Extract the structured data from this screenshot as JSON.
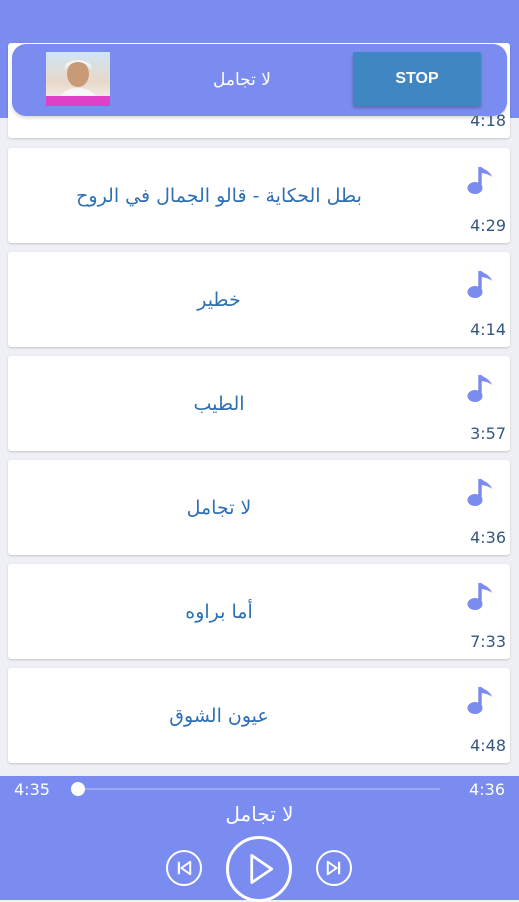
{
  "now_playing": {
    "title": "لا تجامل",
    "stop_label": "STOP"
  },
  "songs": [
    {
      "title": "",
      "duration": "4:18"
    },
    {
      "title": "بطل الحكاية - قالو الجمال في الروح",
      "duration": "4:29"
    },
    {
      "title": "خطير",
      "duration": "4:14"
    },
    {
      "title": "الطيب",
      "duration": "3:57"
    },
    {
      "title": "لا تجامل",
      "duration": "4:36"
    },
    {
      "title": "أما براوه",
      "duration": "7:33"
    },
    {
      "title": "عيون الشوق",
      "duration": "4:48"
    }
  ],
  "player": {
    "elapsed": "4:35",
    "total": "4:36",
    "progress": 0.0,
    "title": "لا تجامل"
  },
  "icons": {
    "song": "music-note-icon",
    "prev": "skip-previous-icon",
    "play": "play-icon",
    "next": "skip-next-icon"
  },
  "colors": {
    "accent": "#7b8cf0",
    "stop_button": "#3f86c3",
    "song_title": "#2f6fb3",
    "note_icon": "#7b8cf0"
  }
}
